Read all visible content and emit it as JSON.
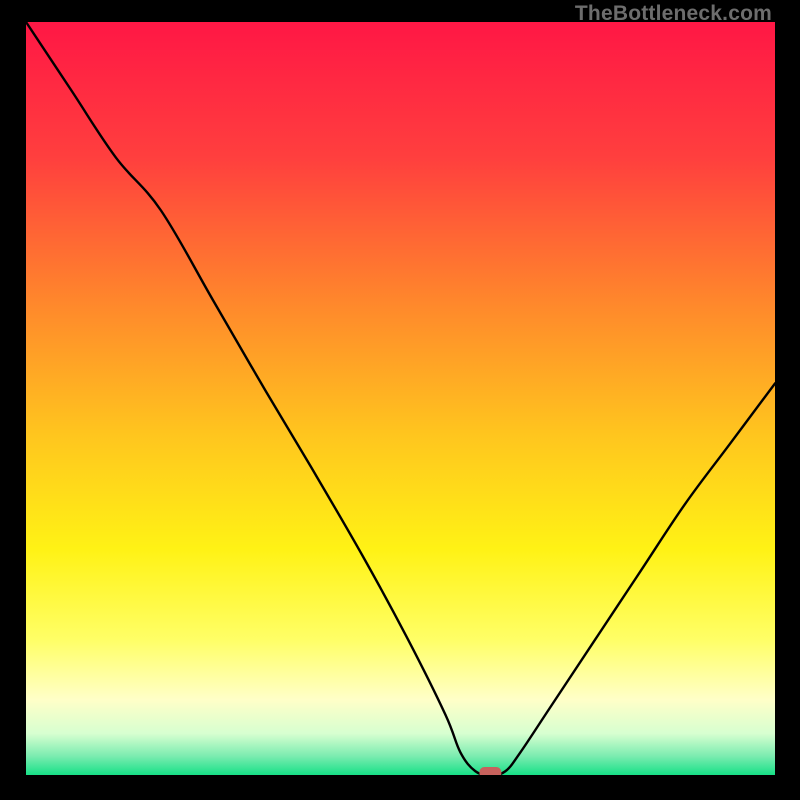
{
  "watermark": "TheBottleneck.com",
  "chart_data": {
    "type": "line",
    "title": "",
    "xlabel": "",
    "ylabel": "",
    "xlim": [
      0,
      100
    ],
    "ylim": [
      0,
      100
    ],
    "grid": false,
    "legend": false,
    "annotations": [],
    "series": [
      {
        "name": "bottleneck-curve",
        "x": [
          0,
          6,
          12,
          18,
          25,
          32,
          38,
          45,
          51,
          56,
          58,
          60,
          62,
          64,
          66,
          70,
          76,
          82,
          88,
          94,
          100
        ],
        "y": [
          100,
          91,
          82,
          75,
          63,
          51,
          41,
          29,
          18,
          8,
          3,
          0.5,
          0,
          0.5,
          3,
          9,
          18,
          27,
          36,
          44,
          52
        ]
      }
    ],
    "marker": {
      "name": "optimal-point",
      "x": 62,
      "y": 0,
      "color": "#c7625d"
    },
    "gradient_stops": [
      {
        "offset": 0.0,
        "color": "#ff1745"
      },
      {
        "offset": 0.18,
        "color": "#ff3f3e"
      },
      {
        "offset": 0.38,
        "color": "#ff8a2b"
      },
      {
        "offset": 0.55,
        "color": "#ffc61e"
      },
      {
        "offset": 0.7,
        "color": "#fff215"
      },
      {
        "offset": 0.82,
        "color": "#ffff66"
      },
      {
        "offset": 0.9,
        "color": "#ffffc8"
      },
      {
        "offset": 0.945,
        "color": "#d7ffd0"
      },
      {
        "offset": 0.975,
        "color": "#7becb0"
      },
      {
        "offset": 1.0,
        "color": "#17e087"
      }
    ]
  }
}
